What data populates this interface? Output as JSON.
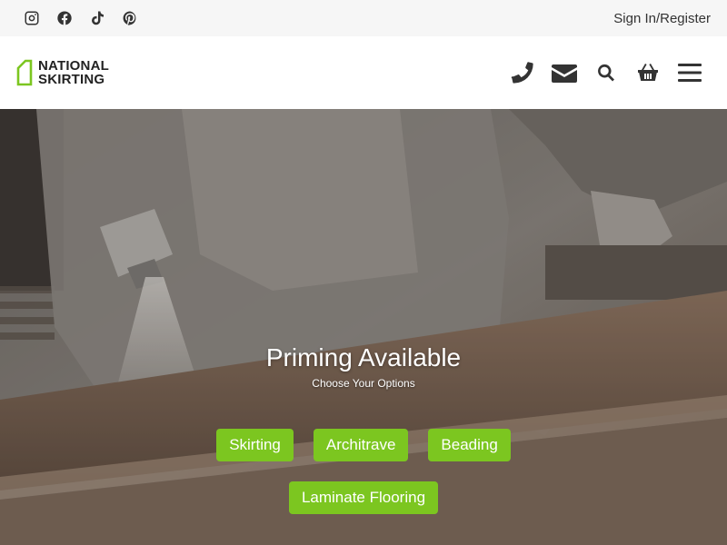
{
  "topbar": {
    "social_icons": [
      "instagram-icon",
      "facebook-icon",
      "tiktok-icon",
      "pinterest-icon"
    ],
    "signin_label": "Sign In/Register"
  },
  "header": {
    "logo_line1": "NATIONAL",
    "logo_line2": "SKIRTING",
    "logo_color": "#7cc620",
    "nav_icons": [
      "phone-icon",
      "email-icon",
      "search-icon",
      "basket-icon",
      "menu-icon"
    ]
  },
  "hero": {
    "title": "Priming Available",
    "subtitle": "Choose Your Options",
    "buttons": [
      "Skirting",
      "Architrave",
      "Beading",
      "Laminate Flooring"
    ],
    "button_color": "#7cc620"
  }
}
